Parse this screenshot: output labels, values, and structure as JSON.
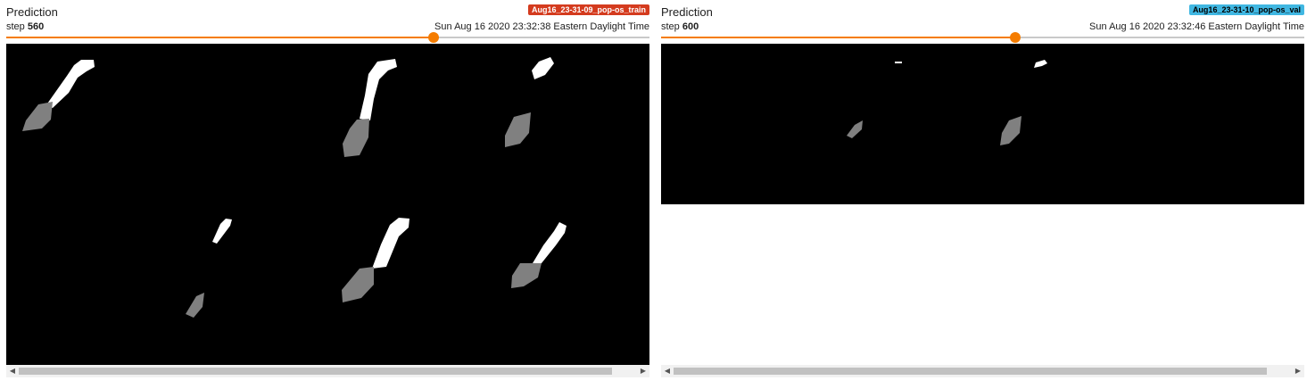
{
  "colors": {
    "accent": "#f57c00",
    "train_chip": "#d43b1e",
    "val_chip": "#40b7e2",
    "background_class": "#000000",
    "class_1": "#ffffff",
    "class_2": "#808080"
  },
  "cards": [
    {
      "title": "Prediction",
      "run_label": "Aug16_23-31-09_pop-os_train",
      "step_label": "step",
      "step_value": "560",
      "timestamp": "Sun Aug 16 2020 23:32:38 Eastern Daylight Time",
      "slider_fraction": 0.665,
      "scroll_position": 0.0,
      "scroll_visible_fraction": 0.96
    },
    {
      "title": "Prediction",
      "run_label": "Aug16_23-31-10_pop-os_val",
      "step_label": "step",
      "step_value": "600",
      "timestamp": "Sun Aug 16 2020 23:32:46 Eastern Daylight Time",
      "slider_fraction": 0.55,
      "scroll_position": 0.0,
      "scroll_visible_fraction": 0.96
    }
  ],
  "icons": {
    "scroll_left": "◀",
    "scroll_right": "▶"
  }
}
